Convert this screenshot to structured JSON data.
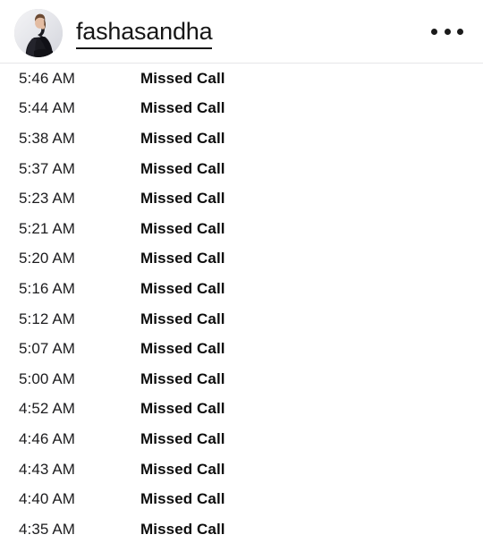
{
  "header": {
    "avatar_alt": "profile-photo",
    "username": "fashasandha",
    "menu_icon": "more-options-icon"
  },
  "call_log": {
    "rows": [
      {
        "time": "5:46 AM",
        "status": "Missed Call"
      },
      {
        "time": "5:44 AM",
        "status": "Missed Call"
      },
      {
        "time": "5:38 AM",
        "status": "Missed Call"
      },
      {
        "time": "5:37 AM",
        "status": "Missed Call"
      },
      {
        "time": "5:23 AM",
        "status": "Missed Call"
      },
      {
        "time": "5:21 AM",
        "status": "Missed Call"
      },
      {
        "time": "5:20 AM",
        "status": "Missed Call"
      },
      {
        "time": "5:16 AM",
        "status": "Missed Call"
      },
      {
        "time": "5:12 AM",
        "status": "Missed Call"
      },
      {
        "time": "5:07 AM",
        "status": "Missed Call"
      },
      {
        "time": "5:00 AM",
        "status": "Missed Call"
      },
      {
        "time": "4:52 AM",
        "status": "Missed Call"
      },
      {
        "time": "4:46 AM",
        "status": "Missed Call"
      },
      {
        "time": "4:43 AM",
        "status": "Missed Call"
      },
      {
        "time": "4:40 AM",
        "status": "Missed Call"
      },
      {
        "time": "4:35 AM",
        "status": "Missed Call"
      }
    ]
  },
  "colors": {
    "background": "#ffffff",
    "primary_text": "#1c1c1e",
    "status_text": "#0d0d0d",
    "divider": "#e6e6e8"
  }
}
